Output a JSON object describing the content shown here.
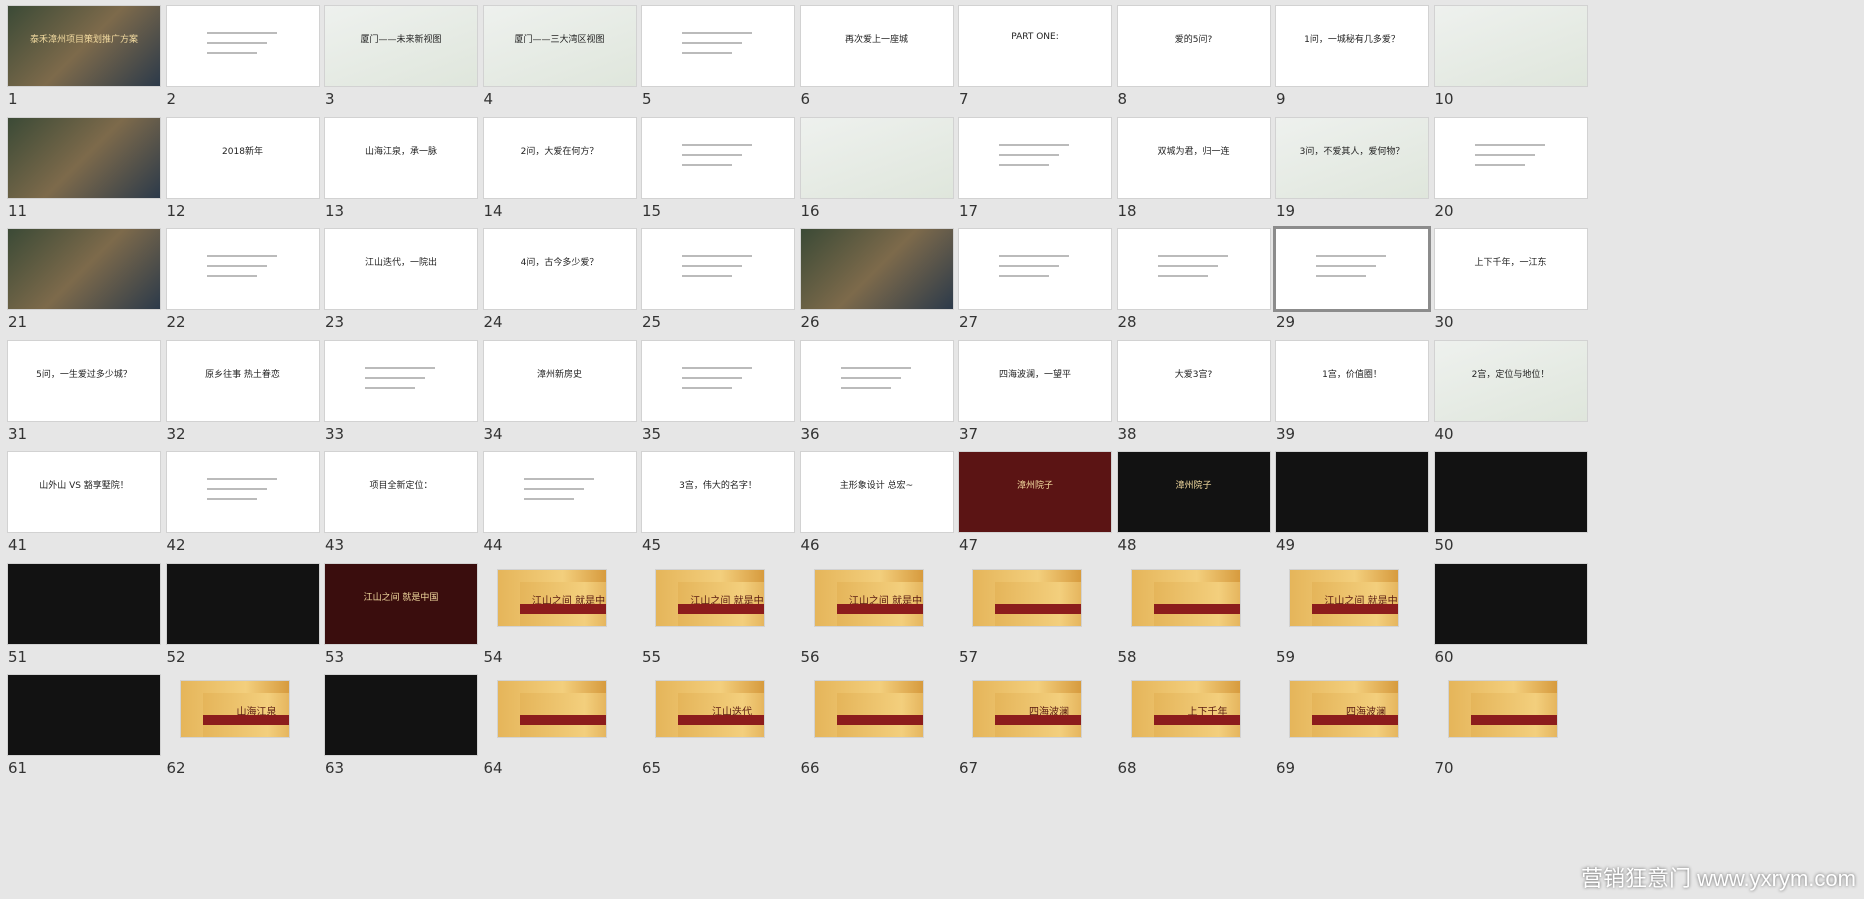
{
  "slides": [
    {
      "n": "1",
      "style": "photo",
      "text": "泰禾漳州项目策划推广方案"
    },
    {
      "n": "2",
      "style": "white",
      "text": ""
    },
    {
      "n": "3",
      "style": "map",
      "text": "厦门——未来新视图"
    },
    {
      "n": "4",
      "style": "map",
      "text": "厦门——三大湾区视图"
    },
    {
      "n": "5",
      "style": "white",
      "text": ""
    },
    {
      "n": "6",
      "style": "white",
      "text": "再次爱上一座城"
    },
    {
      "n": "7",
      "style": "white",
      "text": "PART ONE:"
    },
    {
      "n": "8",
      "style": "white",
      "text": "爱的5问?"
    },
    {
      "n": "9",
      "style": "white",
      "text": "1问，一城秘有几多爱？"
    },
    {
      "n": "10",
      "style": "map",
      "text": ""
    },
    {
      "n": "11",
      "style": "photo",
      "text": ""
    },
    {
      "n": "12",
      "style": "white",
      "text": "2018新年"
    },
    {
      "n": "13",
      "style": "white",
      "text": "山海江泉，承一脉"
    },
    {
      "n": "14",
      "style": "white",
      "text": "2问，大爱在何方？"
    },
    {
      "n": "15",
      "style": "white",
      "text": ""
    },
    {
      "n": "16",
      "style": "map",
      "text": ""
    },
    {
      "n": "17",
      "style": "white",
      "text": ""
    },
    {
      "n": "18",
      "style": "white",
      "text": "双城为君，归一连"
    },
    {
      "n": "19",
      "style": "map",
      "text": "3问，不爱其人，爱何物？"
    },
    {
      "n": "20",
      "style": "white",
      "text": ""
    },
    {
      "n": "21",
      "style": "photo",
      "text": ""
    },
    {
      "n": "22",
      "style": "white",
      "text": ""
    },
    {
      "n": "23",
      "style": "white",
      "text": "江山迭代，一院出"
    },
    {
      "n": "24",
      "style": "white",
      "text": "4问，古今多少爱？"
    },
    {
      "n": "25",
      "style": "white",
      "text": ""
    },
    {
      "n": "26",
      "style": "photo",
      "text": ""
    },
    {
      "n": "27",
      "style": "white",
      "text": ""
    },
    {
      "n": "28",
      "style": "white",
      "text": ""
    },
    {
      "n": "29",
      "style": "white",
      "text": "",
      "selected": true
    },
    {
      "n": "30",
      "style": "white",
      "text": "上下千年，一江东"
    },
    {
      "n": "31",
      "style": "white",
      "text": "5问，一生爱过多少城？"
    },
    {
      "n": "32",
      "style": "white",
      "text": "原乡往事 热土眷恋"
    },
    {
      "n": "33",
      "style": "white",
      "text": ""
    },
    {
      "n": "34",
      "style": "white",
      "text": "漳州新房史"
    },
    {
      "n": "35",
      "style": "white",
      "text": ""
    },
    {
      "n": "36",
      "style": "white",
      "text": ""
    },
    {
      "n": "37",
      "style": "white",
      "text": "四海波澜，一望平"
    },
    {
      "n": "38",
      "style": "white",
      "text": "大爱3宫?"
    },
    {
      "n": "39",
      "style": "white",
      "text": "1宫，价值圈！"
    },
    {
      "n": "40",
      "style": "map",
      "text": "2宫，定位与地位！"
    },
    {
      "n": "41",
      "style": "white",
      "text": "山外山 VS 豁享墅院！"
    },
    {
      "n": "42",
      "style": "white",
      "text": ""
    },
    {
      "n": "43",
      "style": "white",
      "text": "项目全新定位："
    },
    {
      "n": "44",
      "style": "white",
      "text": ""
    },
    {
      "n": "45",
      "style": "white",
      "text": "3宫，伟大的名字！"
    },
    {
      "n": "46",
      "style": "white",
      "text": "主形象设计 总宏~"
    },
    {
      "n": "47",
      "style": "maroon",
      "text": "漳州院子"
    },
    {
      "n": "48",
      "style": "dark",
      "text": "漳州院子"
    },
    {
      "n": "49",
      "style": "dark",
      "text": ""
    },
    {
      "n": "50",
      "style": "dark",
      "text": ""
    },
    {
      "n": "51",
      "style": "dark",
      "text": ""
    },
    {
      "n": "52",
      "style": "dark",
      "text": ""
    },
    {
      "n": "53",
      "style": "darkred",
      "text": "江山之间 就是中国"
    },
    {
      "n": "54",
      "style": "gold",
      "text": "江山之间 就是中国"
    },
    {
      "n": "55",
      "style": "gold",
      "text": "江山之间 就是中国"
    },
    {
      "n": "56",
      "style": "gold",
      "text": "江山之间 就是中国"
    },
    {
      "n": "57",
      "style": "gold",
      "text": ""
    },
    {
      "n": "58",
      "style": "gold",
      "text": ""
    },
    {
      "n": "59",
      "style": "gold",
      "text": "江山之间 就是中国"
    },
    {
      "n": "60",
      "style": "dark",
      "text": ""
    },
    {
      "n": "61",
      "style": "dark",
      "text": ""
    },
    {
      "n": "62",
      "style": "gold",
      "text": "山海江泉"
    },
    {
      "n": "63",
      "style": "dark",
      "text": ""
    },
    {
      "n": "64",
      "style": "gold",
      "text": ""
    },
    {
      "n": "65",
      "style": "gold",
      "text": "江山迭代"
    },
    {
      "n": "66",
      "style": "gold",
      "text": ""
    },
    {
      "n": "67",
      "style": "gold",
      "text": "四海波澜"
    },
    {
      "n": "68",
      "style": "gold",
      "text": "上下千年"
    },
    {
      "n": "69",
      "style": "gold",
      "text": "四海波澜"
    },
    {
      "n": "70",
      "style": "gold",
      "text": ""
    }
  ],
  "watermark": "营销狂意门 www.yxrym.com"
}
